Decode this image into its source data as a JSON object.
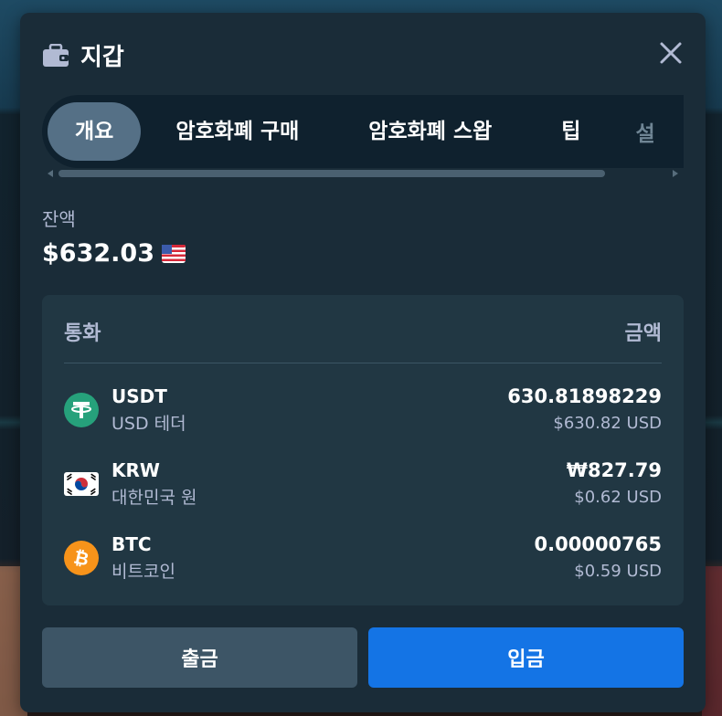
{
  "modal": {
    "title": "지갑",
    "icon": "wallet-icon",
    "close_icon": "close-icon"
  },
  "tabs": [
    {
      "label": "개요",
      "active": true
    },
    {
      "label": "암호화폐 구매",
      "active": false
    },
    {
      "label": "암호화폐 스왑",
      "active": false
    },
    {
      "label": "팁",
      "active": false
    },
    {
      "label": "설",
      "active": false
    }
  ],
  "balance": {
    "label": "잔액",
    "value": "$632.03",
    "flag_icon": "us-flag-icon"
  },
  "table": {
    "header_currency": "통화",
    "header_amount": "금액",
    "rows": [
      {
        "code": "USDT",
        "name": "USD 테더",
        "amount": "630.81898229",
        "usd": "$630.82 USD",
        "icon": "usdt-icon",
        "color": "#26a17b"
      },
      {
        "code": "KRW",
        "name": "대한민국 원",
        "amount": "₩827.79",
        "usd": "$0.62 USD",
        "icon": "korea-flag-icon",
        "color": "#ffffff"
      },
      {
        "code": "BTC",
        "name": "비트코인",
        "amount": "0.00000765",
        "usd": "$0.59 USD",
        "icon": "bitcoin-icon",
        "color": "#f7931a"
      }
    ]
  },
  "buttons": {
    "withdraw": "출금",
    "deposit": "입금"
  },
  "colors": {
    "modal_bg": "#1a2c38",
    "card_bg": "#213743",
    "deposit_blue": "#1474e5",
    "muted_text": "#b1bad3"
  }
}
